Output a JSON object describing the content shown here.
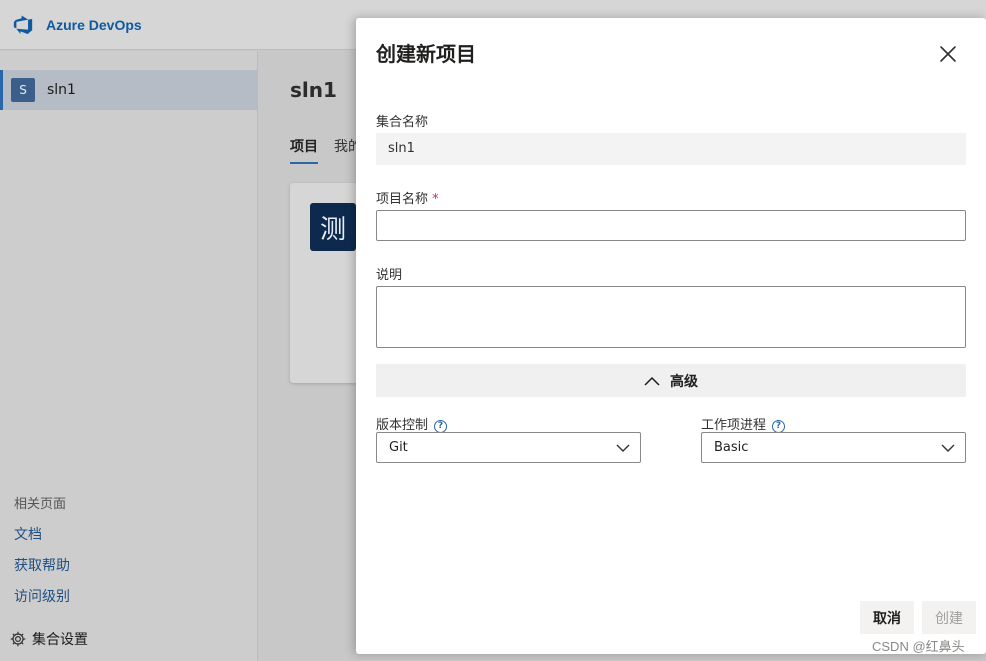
{
  "app": {
    "brand": "Azure DevOps"
  },
  "sidebar": {
    "items": [
      {
        "avatar_letter": "S",
        "label": "sln1"
      }
    ],
    "related_title": "相关页面",
    "related_links": [
      "文档",
      "获取帮助",
      "访问级别"
    ],
    "settings_label": "集合设置"
  },
  "main": {
    "title": "sln1",
    "tabs": [
      {
        "label": "项目"
      },
      {
        "label": "我的"
      }
    ],
    "project_tile": "测"
  },
  "modal": {
    "title": "创建新项目",
    "collection": {
      "label": "集合名称",
      "value": "sln1"
    },
    "project_name": {
      "label": "项目名称",
      "required_mark": "*",
      "value": ""
    },
    "description": {
      "label": "说明",
      "value": ""
    },
    "advanced_label": "高级",
    "version_control": {
      "label": "版本控制",
      "value": "Git"
    },
    "work_item_process": {
      "label": "工作项进程",
      "value": "Basic"
    },
    "cancel_label": "取消",
    "create_label": "创建"
  },
  "colors": {
    "accent": "#2a67a8",
    "brand": "#0e5a9e",
    "required": "#c4314b"
  },
  "watermark": "CSDN @红鼻头"
}
